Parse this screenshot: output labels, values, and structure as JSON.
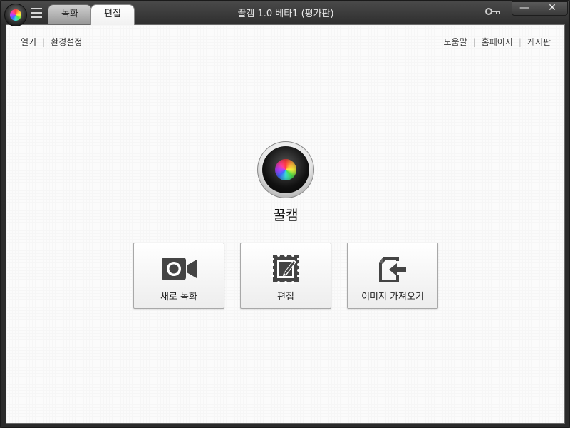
{
  "window": {
    "title": "꿀캠 1.0 베타1 (평가판)",
    "minimize_label": "—",
    "close_label": "✕"
  },
  "tabs": [
    {
      "label": "녹화"
    },
    {
      "label": "편집"
    }
  ],
  "links_left": [
    "열기",
    "환경설정"
  ],
  "links_right": [
    "도움말",
    "홈페이지",
    "게시판"
  ],
  "app_name": "꿀캠",
  "actions": [
    {
      "label": "새로 녹화",
      "icon": "video-camera-icon"
    },
    {
      "label": "편집",
      "icon": "edit-document-icon"
    },
    {
      "label": "이미지 가져오기",
      "icon": "import-image-icon"
    }
  ],
  "colors": {
    "accent_dark": "#2b2b2b",
    "icon_color": "#444444"
  }
}
